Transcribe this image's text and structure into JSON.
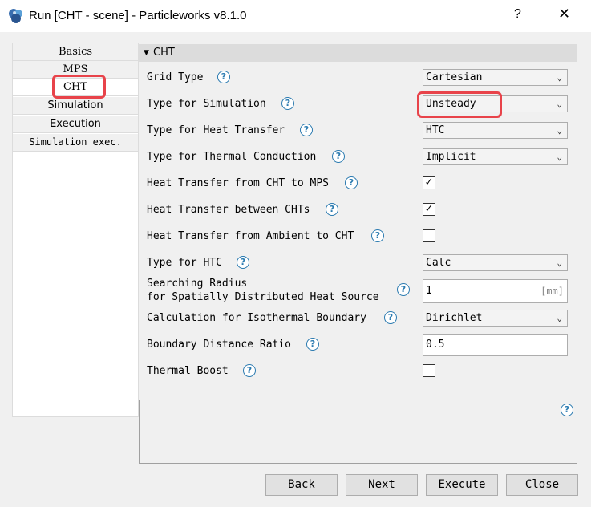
{
  "window": {
    "title": "Run [CHT - scene] - Particleworks v8.1.0",
    "help_label": "?",
    "close_label": "✕"
  },
  "nav": {
    "items": [
      {
        "label": "Basics"
      },
      {
        "label": "MPS"
      },
      {
        "label": "CHT",
        "selected": true
      },
      {
        "label": "Simulation"
      },
      {
        "label": "Execution"
      },
      {
        "label": "Simulation exec."
      }
    ]
  },
  "panel": {
    "header": "CHT",
    "rows": [
      {
        "label": "Grid Type",
        "control": "select",
        "value": "Cartesian"
      },
      {
        "label": "Type for Simulation",
        "control": "select",
        "value": "Unsteady"
      },
      {
        "label": "Type for Heat Transfer",
        "control": "select",
        "value": "HTC"
      },
      {
        "label": "Type for Thermal Conduction",
        "control": "select",
        "value": "Implicit"
      },
      {
        "label": "Heat Transfer from CHT to MPS",
        "control": "checkbox",
        "checked": true
      },
      {
        "label": "Heat Transfer between CHTs",
        "control": "checkbox",
        "checked": true
      },
      {
        "label": "Heat Transfer from Ambient to CHT",
        "control": "checkbox",
        "checked": false
      },
      {
        "label": "Type for HTC",
        "control": "select",
        "value": "Calc"
      },
      {
        "label_line1": "Searching Radius",
        "label_line2": "for Spatially Distributed Heat Source",
        "control": "text",
        "value": "1",
        "unit": "[mm]"
      },
      {
        "label": "Calculation for Isothermal Boundary",
        "control": "select",
        "value": "Dirichlet"
      },
      {
        "label": "Boundary Distance Ratio",
        "control": "text",
        "value": "0.5"
      },
      {
        "label": "Thermal Boost",
        "control": "checkbox",
        "checked": false
      }
    ]
  },
  "help_glyph": "?",
  "check_glyph": "✓",
  "chevron_glyph": "⌄",
  "buttons": {
    "back": "Back",
    "next": "Next",
    "execute": "Execute",
    "close": "Close"
  },
  "colors": {
    "highlight": "#e8434a",
    "help_icon": "#2a7ab0"
  }
}
